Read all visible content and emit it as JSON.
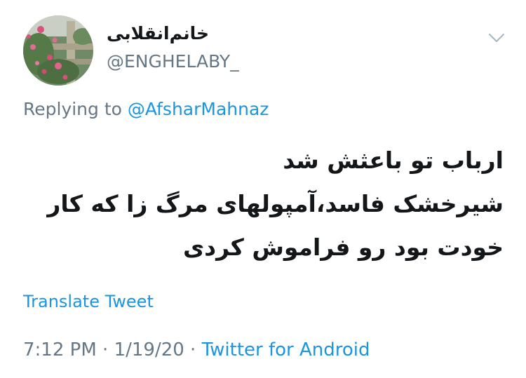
{
  "author": {
    "display_name": "خانم‌انقلابی",
    "handle": "@ENGHELABY_",
    "avatar": "rose-garden-photo"
  },
  "icons": {
    "caret": "chevron-down-icon"
  },
  "reply": {
    "prefix": "Replying to",
    "mention": "@AfsharMahnaz"
  },
  "tweet": {
    "lines": [
      "ارباب تو باعثش شد",
      "شیرخشک فاسد،آمپولهای مرگ زا که کار",
      "خودت بود رو فراموش کردی"
    ]
  },
  "translate_label": "Translate Tweet",
  "meta": {
    "time": "7:12 PM",
    "separator": " · ",
    "date": "1/19/20",
    "source": "Twitter for Android"
  },
  "colors": {
    "link": "#1b95e0",
    "secondary": "#657786",
    "text": "#14171a"
  }
}
